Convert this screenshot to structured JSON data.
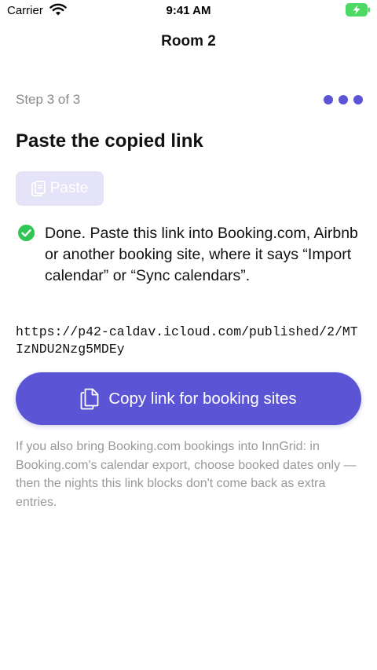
{
  "status_bar": {
    "carrier": "Carrier",
    "time": "9:41 AM"
  },
  "nav": {
    "title": "Room 2"
  },
  "step": {
    "label": "Step 3 of 3",
    "total_dots": 3
  },
  "heading": "Paste the copied link",
  "paste_button": {
    "label": "Paste",
    "icon": "paste-clipboard-icon"
  },
  "done": {
    "icon": "check-circle-icon",
    "message": "Done. Paste this link into Booking.com, Airbnb or another booking site, where it says “Import calendar” or “Sync calendars”."
  },
  "link": {
    "url": "https://p42-caldav.icloud.com/published/2/MTIzNDU2Nzg5MDEy"
  },
  "copy_button": {
    "label": "Copy link for booking sites",
    "icon": "copy-document-icon"
  },
  "footnote": "If you also bring Booking.com bookings into InnGrid: in Booking.com's calendar export, choose booked dates only — then the nights this link blocks don't come back as extra entries.",
  "colors": {
    "accent": "#5b55d6",
    "accent_disabled": "#e4e3f8",
    "success": "#2fc655",
    "battery_charging": "#4cd964",
    "secondary_text": "#98989d"
  }
}
